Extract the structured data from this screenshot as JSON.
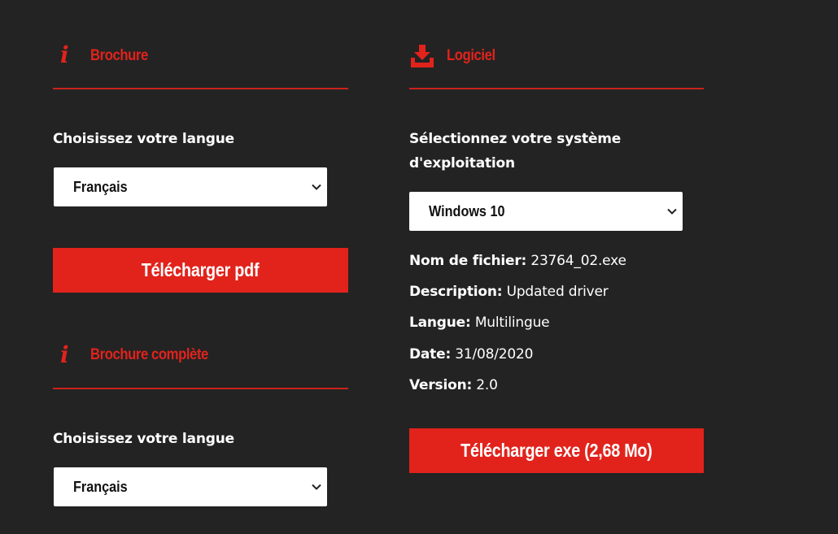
{
  "brochure": {
    "title": "Brochure",
    "lang_label": "Choisissez votre langue",
    "lang_value": "Français",
    "download_label": "Télécharger pdf"
  },
  "brochure_complete": {
    "title": "Brochure complète",
    "lang_label": "Choisissez votre langue",
    "lang_value": "Français"
  },
  "software": {
    "title": "Logiciel",
    "os_label": "Sélectionnez votre système d'exploitation",
    "os_value": "Windows 10",
    "details": [
      {
        "key": "Nom de fichier:",
        "value": "23764_02.exe"
      },
      {
        "key": "Description:",
        "value": "Updated driver"
      },
      {
        "key": "Langue:",
        "value": "Multilingue"
      },
      {
        "key": "Date:",
        "value": "31/08/2020"
      },
      {
        "key": "Version:",
        "value": "2.0"
      }
    ],
    "download_label": "Télécharger exe (2,68 Mo)"
  },
  "icons": {
    "info": "info-icon",
    "download": "download-tray-icon",
    "select_arrow": "chevron-down-icon"
  },
  "colors": {
    "background": "#232323",
    "accent": "#e1231c",
    "select_bg": "#ffffff"
  }
}
